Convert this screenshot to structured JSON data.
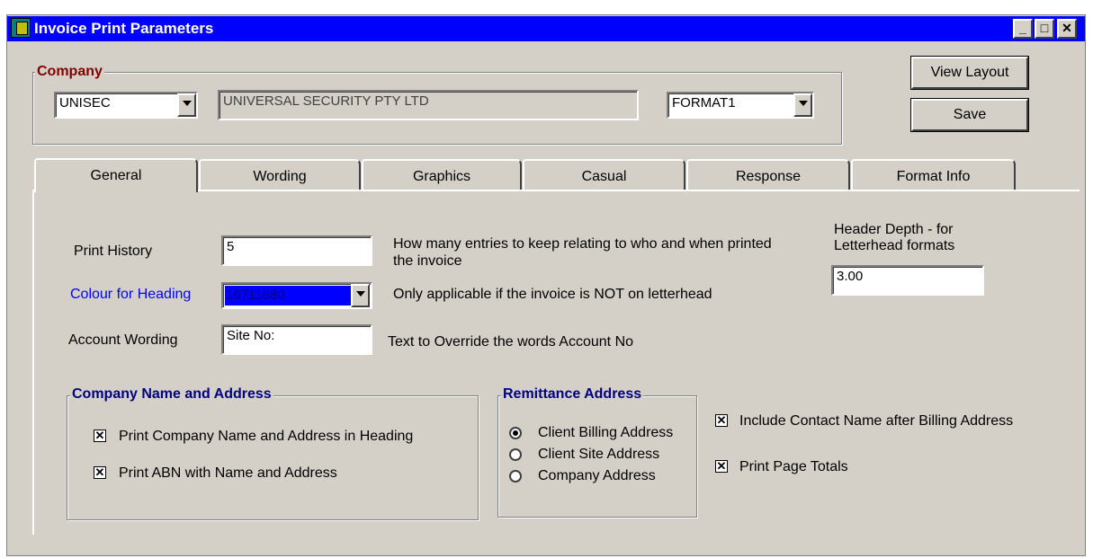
{
  "window": {
    "title": "Invoice Print Parameters",
    "minimize_glyph": "_",
    "maximize_glyph": "□",
    "close_glyph": "✕"
  },
  "company": {
    "legend": "Company",
    "code": "UNISEC",
    "name": "UNIVERSAL SECURITY PTY LTD",
    "format": "FORMAT1"
  },
  "buttons": {
    "view_layout": "View Layout",
    "save": "Save"
  },
  "tabs": [
    {
      "label": "General",
      "active": true
    },
    {
      "label": "Wording",
      "active": false
    },
    {
      "label": "Graphics",
      "active": false
    },
    {
      "label": "Casual",
      "active": false
    },
    {
      "label": "Response",
      "active": false
    },
    {
      "label": "Format Info",
      "active": false
    }
  ],
  "general": {
    "print_history": {
      "label": "Print History",
      "value": "5",
      "help": "How many entries to keep relating to who and when printed the invoice"
    },
    "colour_heading": {
      "label": "Colour for Heading",
      "value": "16711680",
      "help": "Only applicable if the invoice is NOT on letterhead",
      "label_color": "#0000ff",
      "swatch_color": "#0000ff"
    },
    "account_wording": {
      "label": "Account Wording",
      "value": "Site No:",
      "help": "Text to Override the words Account No"
    },
    "header_depth": {
      "label_line1": "Header Depth - for",
      "label_line2": "Letterhead formats",
      "value": "3.00"
    },
    "company_name_address": {
      "legend": "Company Name and Address",
      "print_in_heading": {
        "label": "Print Company Name and Address in Heading",
        "checked": true
      },
      "print_abn": {
        "label": "Print ABN with Name and Address",
        "checked": true
      }
    },
    "remittance": {
      "legend": "Remittance Address",
      "options": [
        {
          "label": "Client Billing Address",
          "selected": true
        },
        {
          "label": "Client Site Address",
          "selected": false
        },
        {
          "label": "Company Address",
          "selected": false
        }
      ]
    },
    "include_contact": {
      "label": "Include Contact Name after Billing Address",
      "checked": true
    },
    "print_page_totals": {
      "label": "Print Page Totals",
      "checked": true
    }
  },
  "check_glyph": "✕",
  "colors": {
    "title_bar": "#0000ff",
    "face": "#d4d0c8",
    "legend_red": "#800000",
    "legend_blue": "#000080"
  }
}
